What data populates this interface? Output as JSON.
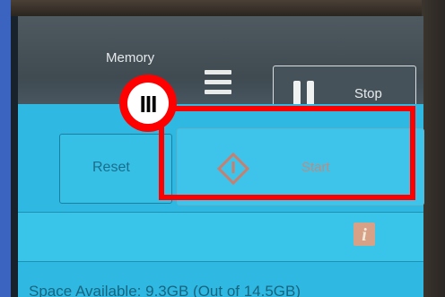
{
  "header": {
    "memory_label": "Memory",
    "stop_label": "Stop"
  },
  "buttons": {
    "reset_label": "Reset",
    "start_label": "Start"
  },
  "info": {
    "info_glyph": "i",
    "space_available": "Space Available: 9.3GB (Out of 14.5GB)"
  },
  "annotation": {
    "step_label": "III",
    "highlight_color": "#ff0000"
  },
  "icons": [
    "menu-icon",
    "pause-icon",
    "start-diamond-icon",
    "info-icon"
  ],
  "colors": {
    "panel": "#2fb9e2",
    "background": "#3b63c0",
    "topbar": "#46525a"
  }
}
